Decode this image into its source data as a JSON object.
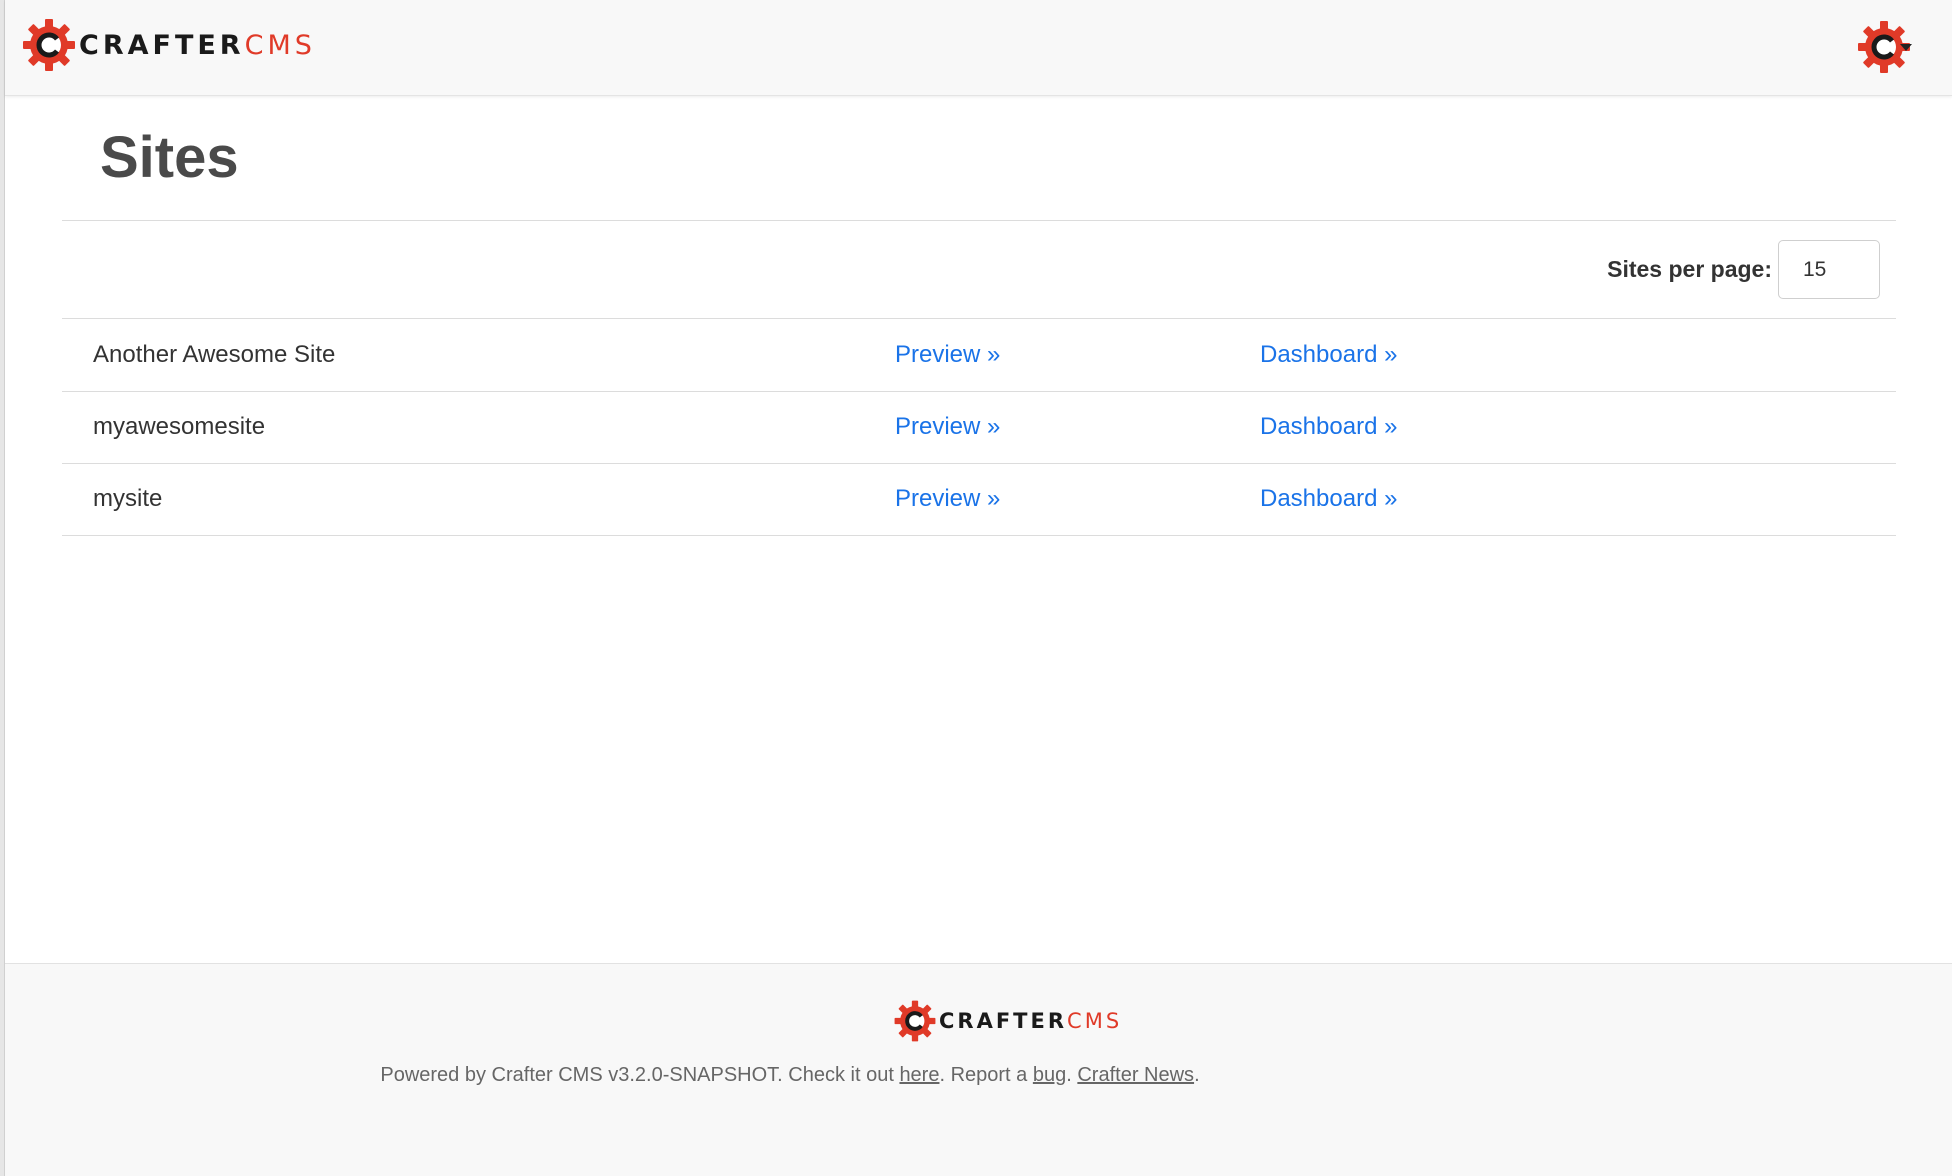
{
  "brand": {
    "part1": "CRAFTER",
    "part2": "CMS",
    "accent_color": "#e03a28"
  },
  "header": {
    "logo_icon": "crafter-gear-icon",
    "user_menu_icon": "crafter-avatar-icon"
  },
  "page": {
    "title": "Sites"
  },
  "pagination": {
    "label": "Sites per page:",
    "value": "15"
  },
  "sites": [
    {
      "name": "Another Awesome Site",
      "preview": "Preview »",
      "dashboard": "Dashboard »"
    },
    {
      "name": "myawesomesite",
      "preview": "Preview »",
      "dashboard": "Dashboard »"
    },
    {
      "name": "mysite",
      "preview": "Preview »",
      "dashboard": "Dashboard »"
    }
  ],
  "footer": {
    "prefix": "Powered by Crafter CMS v3.2.0-SNAPSHOT. Check it out ",
    "here": "here",
    "mid1": ". Report a ",
    "bug": "bug",
    "mid2": ". ",
    "news": "Crafter News",
    "suffix": "."
  },
  "link_color": "#1a73e8"
}
